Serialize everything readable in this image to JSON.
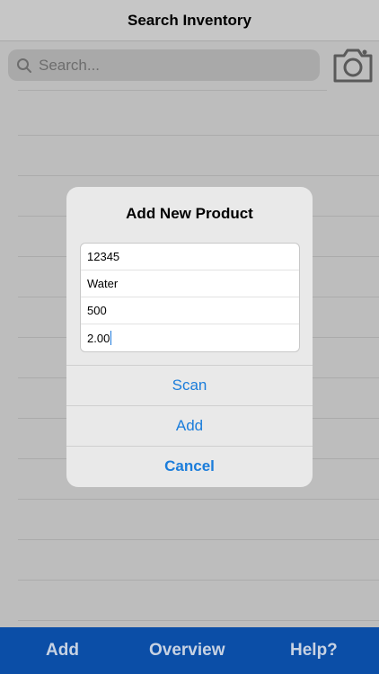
{
  "navbar": {
    "title": "Search Inventory"
  },
  "search": {
    "placeholder": "Search..."
  },
  "icons": {
    "search": "search-icon",
    "camera": "camera-icon"
  },
  "dialog": {
    "title": "Add New Product",
    "fields": [
      "12345",
      "Water",
      "500",
      "2.00"
    ],
    "actions": {
      "scan": "Scan",
      "add": "Add",
      "cancel": "Cancel"
    }
  },
  "tabbar": {
    "items": [
      "Add",
      "Overview",
      "Help?"
    ]
  },
  "colors": {
    "accent": "#1b7ddb",
    "tabbar_bg": "#0b4ea7",
    "tabbar_text": "#c7d2e3",
    "dimmed_bg": "#bdbdbd"
  }
}
